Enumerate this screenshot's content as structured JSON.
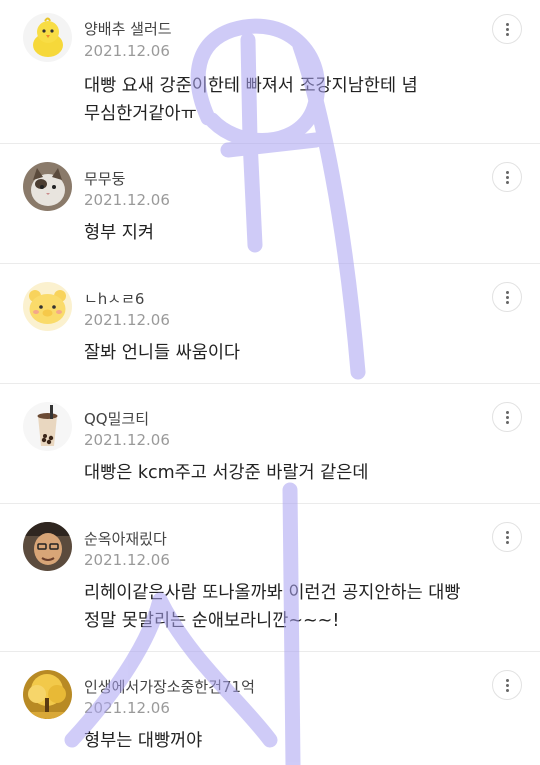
{
  "comments": [
    {
      "nickname": "양배추 샐러드",
      "date": "2021.12.06",
      "lines": [
        "대빵 요새 강준이한테 빠져서 조강지남한테 념",
        "무심한거같아ㅠ"
      ],
      "avatar": "yellow-chick-avatar"
    },
    {
      "nickname": "무무둥",
      "date": "2021.12.06",
      "lines": [
        "형부 지켜"
      ],
      "avatar": "cat-photo-avatar"
    },
    {
      "nickname": "ㄴhㅅㄹ6",
      "date": "2021.12.06",
      "lines": [
        "잘봐 언니들 싸움이다"
      ],
      "avatar": "yellow-bear-avatar"
    },
    {
      "nickname": "QQ밀크티",
      "date": "2021.12.06",
      "lines": [
        "대빵은 kcm주고 서강준 바랄거 같은데"
      ],
      "avatar": "bubble-tea-avatar"
    },
    {
      "nickname": "순옥아재맀다",
      "date": "2021.12.06",
      "lines": [
        "리헤이같은사람 또나올까봐 이런건 공지안하는 대빵",
        "정말 못말리는 순애보라니깐~~~!"
      ],
      "avatar": "man-photo-avatar"
    },
    {
      "nickname": "인생에서가장소중한건71억",
      "date": "2021.12.06",
      "lines": [
        "형부는 대빵꺼야"
      ],
      "avatar": "golden-tree-avatar"
    }
  ],
  "colors": {
    "scribble": "#a9a2f2",
    "nickname": "#444444",
    "date": "#9a9a9a",
    "text": "#222222",
    "divider": "#ebebeb"
  },
  "icons": {
    "more": "vertical-dots-icon"
  }
}
